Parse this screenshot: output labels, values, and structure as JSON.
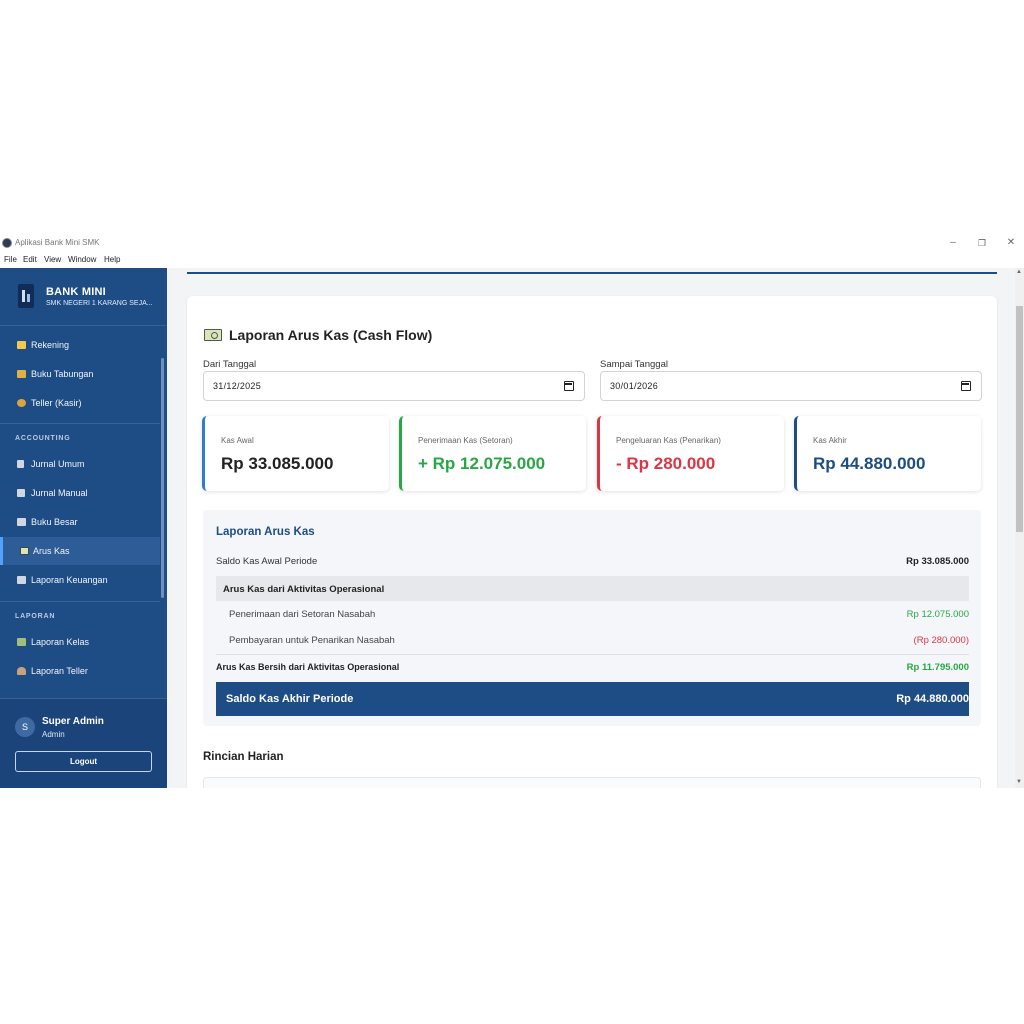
{
  "window": {
    "title": "Aplikasi Bank Mini SMK",
    "controls": {
      "minimize": "–",
      "maximize": "❐",
      "close": "✕"
    }
  },
  "menu": [
    "File",
    "Edit",
    "View",
    "Window",
    "Help"
  ],
  "sidebar": {
    "brand_title": "BANK MINI",
    "brand_subtitle": "SMK NEGERI 1 KARANG SEJA...",
    "items_top": [
      {
        "label": "Rekening",
        "icon": "card-icon",
        "color": "#f2c94c"
      },
      {
        "label": "Buku Tabungan",
        "icon": "book-icon",
        "color": "#e0b040"
      },
      {
        "label": "Teller (Kasir)",
        "icon": "money-bag-icon",
        "color": "#d9a441"
      }
    ],
    "section_accounting": "ACCOUNTING",
    "items_accounting": [
      {
        "label": "Jurnal Umum",
        "icon": "notebook-icon",
        "color": "#d0d7e2"
      },
      {
        "label": "Jurnal Manual",
        "icon": "document-icon",
        "color": "#d0d7e2"
      },
      {
        "label": "Buku Besar",
        "icon": "open-book-icon",
        "color": "#d0d7e2"
      },
      {
        "label": "Arus Kas",
        "icon": "cash-icon",
        "color": "#d8e6b8",
        "active": true
      },
      {
        "label": "Laporan Keuangan",
        "icon": "chart-icon",
        "color": "#d0d7e2"
      }
    ],
    "section_laporan": "LAPORAN",
    "items_laporan": [
      {
        "label": "Laporan Kelas",
        "icon": "class-icon",
        "color": "#9fbf7a"
      },
      {
        "label": "Laporan Teller",
        "icon": "person-icon",
        "color": "#c9a27a"
      }
    ],
    "user": {
      "initial": "S",
      "name": "Super Admin",
      "role": "Admin",
      "logout_label": "Logout"
    }
  },
  "main": {
    "page_title": "Laporan Arus Kas (Cash Flow)",
    "page_icon": "cash-icon",
    "filters": {
      "from_label": "Dari Tanggal",
      "from_value": "31/12/2025",
      "to_label": "Sampai Tanggal",
      "to_value": "30/01/2026"
    },
    "stats": [
      {
        "label": "Kas Awal",
        "value": "Rp 33.085.000",
        "color": "#222222",
        "accent": "#2f7dd1"
      },
      {
        "label": "Penerimaan Kas (Setoran)",
        "value": "+ Rp 12.075.000",
        "color": "#28a745",
        "accent": "#28a745"
      },
      {
        "label": "Pengeluaran Kas (Penarikan)",
        "value": "- Rp 280.000",
        "color": "#dc3545",
        "accent": "#dc3545"
      },
      {
        "label": "Kas Akhir",
        "value": "Rp 44.880.000",
        "color": "#1e4c85",
        "accent": "#1e4c85"
      }
    ],
    "report": {
      "title": "Laporan Arus Kas",
      "opening_label": "Saldo Kas Awal Periode",
      "opening_value": "Rp 33.085.000",
      "operating_header": "Arus Kas dari Aktivitas Operasional",
      "receipts_label": "Penerimaan dari Setoran Nasabah",
      "receipts_value": "Rp 12.075.000",
      "payments_label": "Pembayaran untuk Penarikan Nasabah",
      "payments_value": "(Rp 280.000)",
      "net_label": "Arus Kas Bersih dari Aktivitas Operasional",
      "net_value": "Rp 11.795.000",
      "closing_label": "Saldo Kas Akhir Periode",
      "closing_value": "Rp 44.880.000"
    },
    "daily_title": "Rincian Harian"
  },
  "colors": {
    "primary": "#1e4c85",
    "success": "#28a745",
    "danger": "#dc3545"
  }
}
